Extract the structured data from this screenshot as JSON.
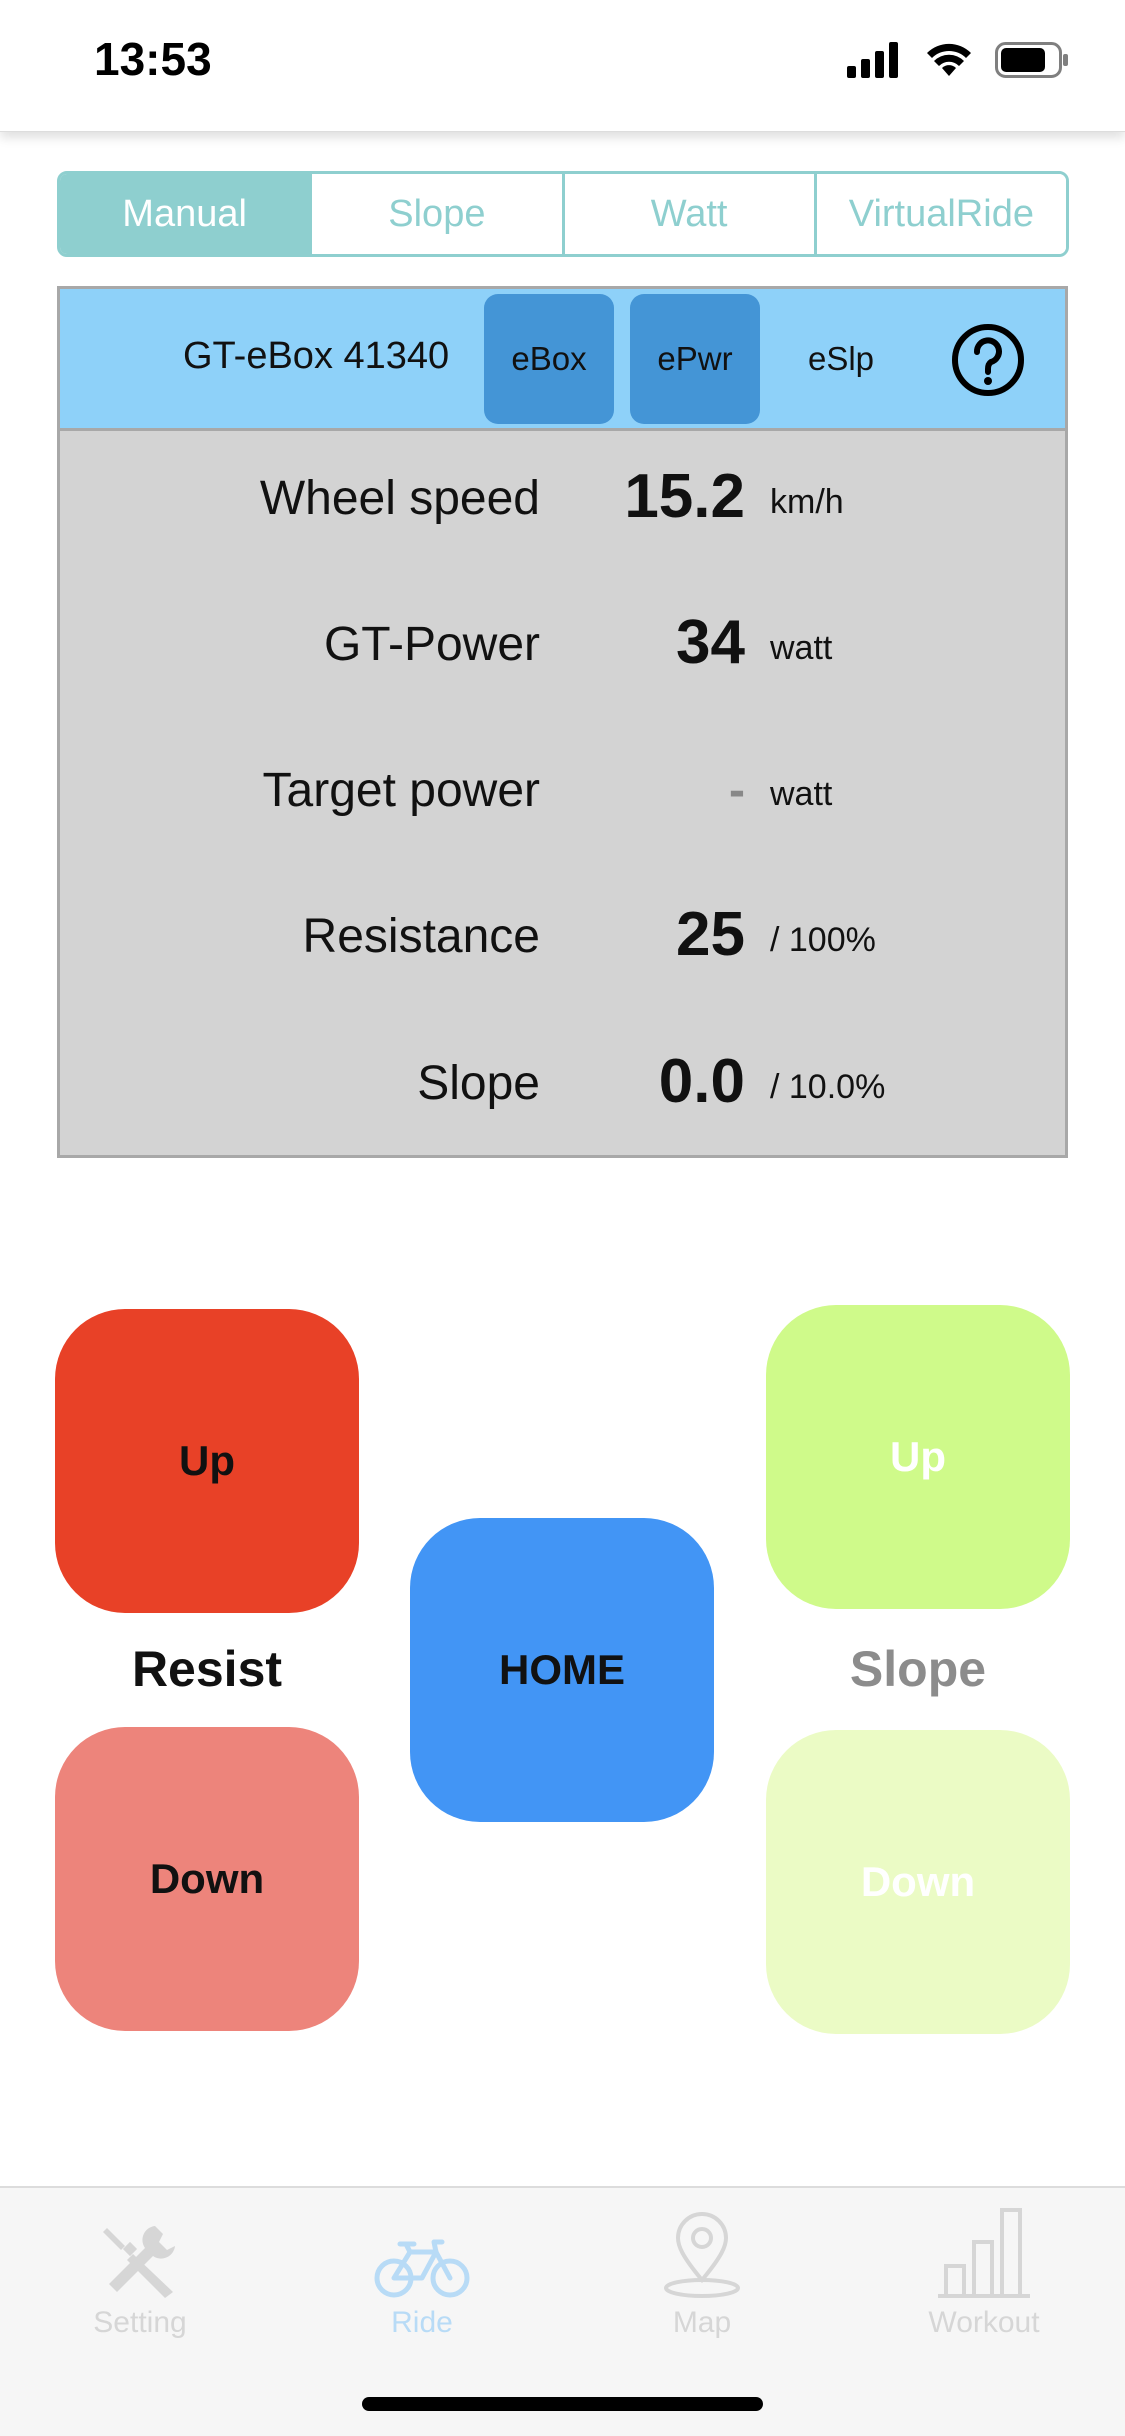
{
  "status_bar": {
    "time": "13:53"
  },
  "segments": [
    {
      "label": "Manual",
      "active": true
    },
    {
      "label": "Slope",
      "active": false
    },
    {
      "label": "Watt",
      "active": false
    },
    {
      "label": "VirtualRide",
      "active": false
    }
  ],
  "panel": {
    "device_name": "GT-eBox 41340",
    "buttons": [
      {
        "label": "eBox",
        "active": true
      },
      {
        "label": "ePwr",
        "active": true
      },
      {
        "label": "eSlp",
        "active": false
      }
    ],
    "rows": [
      {
        "label": "Wheel speed",
        "value": "15.2",
        "unit": "km/h"
      },
      {
        "label": "GT-Power",
        "value": "34",
        "unit": "watt"
      },
      {
        "label": "Target power",
        "value": "-",
        "unit": "watt"
      },
      {
        "label": "Resistance",
        "value": "25",
        "unit": "/ 100%"
      },
      {
        "label": "Slope",
        "value": "0.0",
        "unit": "/ 10.0%"
      }
    ]
  },
  "controls": {
    "resist_label": "Resist",
    "resist_up": "Up",
    "resist_down": "Down",
    "home": "HOME",
    "slope_label": "Slope",
    "slope_up": "Up",
    "slope_down": "Down"
  },
  "colors": {
    "resist_up": "#e84127",
    "resist_down": "#ed847b",
    "home": "#4295f5",
    "slope_up": "#cffa8a",
    "slope_down": "#ebfbc5",
    "accent": "#8ecfcf",
    "panel_header": "#8ed1f9"
  },
  "tab_bar": [
    {
      "label": "Setting",
      "icon": "tools-icon",
      "active": false
    },
    {
      "label": "Ride",
      "icon": "bicycle-icon",
      "active": true
    },
    {
      "label": "Map",
      "icon": "map-pin-icon",
      "active": false
    },
    {
      "label": "Workout",
      "icon": "bar-chart-icon",
      "active": false
    }
  ]
}
